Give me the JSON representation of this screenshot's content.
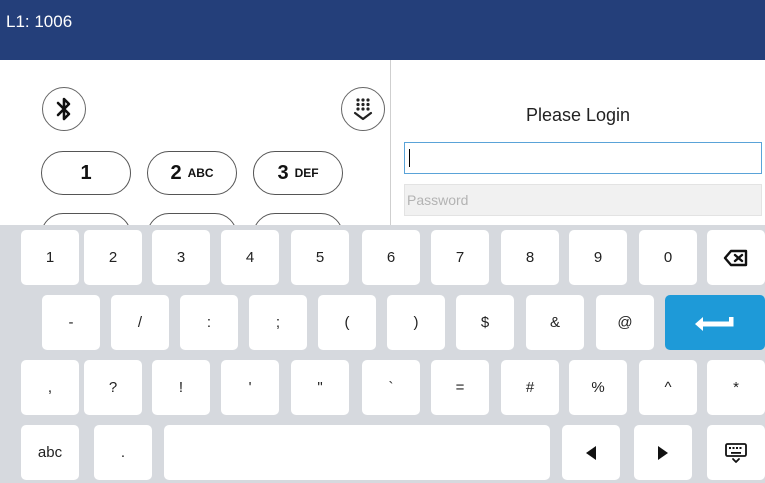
{
  "titlebar": {
    "line": "L1: 1006"
  },
  "dialpad": {
    "bluetooth_icon": "bluetooth-icon",
    "dialpad_toggle_icon": "dialpad-down-icon",
    "keys": [
      {
        "digit": "1",
        "letters": ""
      },
      {
        "digit": "2",
        "letters": "ABC"
      },
      {
        "digit": "3",
        "letters": "DEF"
      }
    ]
  },
  "login": {
    "title": "Please Login",
    "username_value": "",
    "password_placeholder": "Password"
  },
  "keyboard": {
    "row1": [
      "1",
      "2",
      "3",
      "4",
      "5",
      "6",
      "7",
      "8",
      "9",
      "0"
    ],
    "row1_backspace_icon": "backspace-icon",
    "row2": [
      "-",
      "/",
      ":",
      ";",
      "(",
      ")",
      "$",
      "&",
      "@"
    ],
    "row2_enter_icon": "enter-icon",
    "row3": [
      ",",
      "?",
      "!",
      "'",
      "\"",
      "`",
      "=",
      "#",
      "%",
      "^",
      "*"
    ],
    "row4": {
      "mode_label": "abc",
      "period_label": ".",
      "left_icon": "arrow-left-icon",
      "right_icon": "arrow-right-icon",
      "hide_icon": "keyboard-hide-icon"
    },
    "enter_color": "#1e9ad8"
  },
  "colors": {
    "titlebar": "#243f7a",
    "keyboard_bg": "#d6d9de"
  }
}
